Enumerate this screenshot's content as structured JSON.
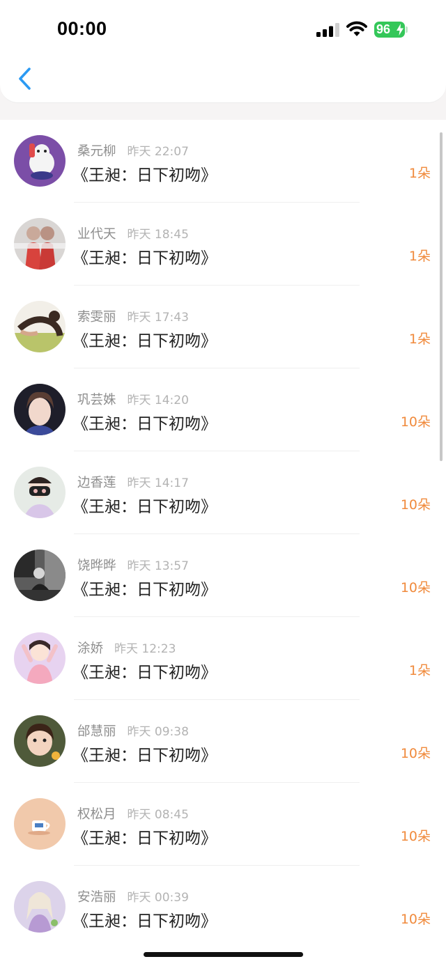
{
  "status_bar": {
    "time": "00:00",
    "battery": "96"
  },
  "colors": {
    "accent": "#f08a3c",
    "back_arrow": "#2b9af3",
    "battery": "#34c759"
  },
  "header": {
    "back_icon": "chevron-left-icon"
  },
  "records": [
    {
      "name": "桑元柳",
      "time": "昨天 22:07",
      "title": "《王昶：日下初吻》",
      "flowers": "1朵",
      "avatar": "cartoon-bear-avatar"
    },
    {
      "name": "业代天",
      "time": "昨天 18:45",
      "title": "《王昶：日下初吻》",
      "flowers": "1朵",
      "avatar": "couple-photo-avatar"
    },
    {
      "name": "索雯丽",
      "time": "昨天 17:43",
      "title": "《王昶：日下初吻》",
      "flowers": "1朵",
      "avatar": "outdoor-photo-avatar"
    },
    {
      "name": "巩芸姝",
      "time": "昨天 14:20",
      "title": "《王昶：日下初吻》",
      "flowers": "10朵",
      "avatar": "portrait-avatar"
    },
    {
      "name": "边香莲",
      "time": "昨天 14:17",
      "title": "《王昶：日下初吻》",
      "flowers": "10朵",
      "avatar": "masked-girl-avatar"
    },
    {
      "name": "饶晔晔",
      "time": "昨天 13:57",
      "title": "《王昶：日下初吻》",
      "flowers": "10朵",
      "avatar": "monochrome-photo-avatar"
    },
    {
      "name": "涂娇",
      "time": "昨天 12:23",
      "title": "《王昶：日下初吻》",
      "flowers": "1朵",
      "avatar": "drawn-girl-avatar"
    },
    {
      "name": "邰慧丽",
      "time": "昨天 09:38",
      "title": "《王昶：日下初吻》",
      "flowers": "10朵",
      "avatar": "child-photo-avatar"
    },
    {
      "name": "权松月",
      "time": "昨天 08:45",
      "title": "《王昶：日下初吻》",
      "flowers": "10朵",
      "avatar": "cup-illustration-avatar"
    },
    {
      "name": "安浩丽",
      "time": "昨天 00:39",
      "title": "《王昶：日下初吻》",
      "flowers": "10朵",
      "avatar": "anime-girl-avatar"
    }
  ]
}
